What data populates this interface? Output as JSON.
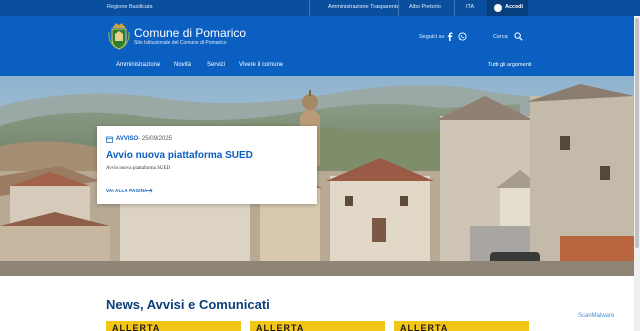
{
  "topbar": {
    "region": "Regione Basilicata",
    "links": [
      "Amministrazione Trasparente",
      "Albo Pretorio",
      "ITA"
    ],
    "login": "Accedi"
  },
  "header": {
    "title": "Comune di Pomarico",
    "subtitle": "Sito Istituzionale del Comune di Pomarico",
    "follow": "Seguici su",
    "search": "Cerca"
  },
  "nav": {
    "items": [
      "Amministrazione",
      "Novità",
      "Servizi",
      "Vivere il comune"
    ],
    "right": "Tutti gli argomenti"
  },
  "card": {
    "category": "AVVISO",
    "date": "- 25/09/2025",
    "title": "Avvio nuova piattaforma SUED",
    "description": "Avvio nuova piattaforma SUED",
    "more": "VAI ALLA PAGINA"
  },
  "news": {
    "title": "News, Avvisi e Comunicati",
    "thumb_text": "ALLERTA"
  },
  "watermark": "ScanMalware",
  "colors": {
    "brand": "#0b5fc1",
    "topbar": "#0a4f9e",
    "heading": "#0b3f7a"
  }
}
